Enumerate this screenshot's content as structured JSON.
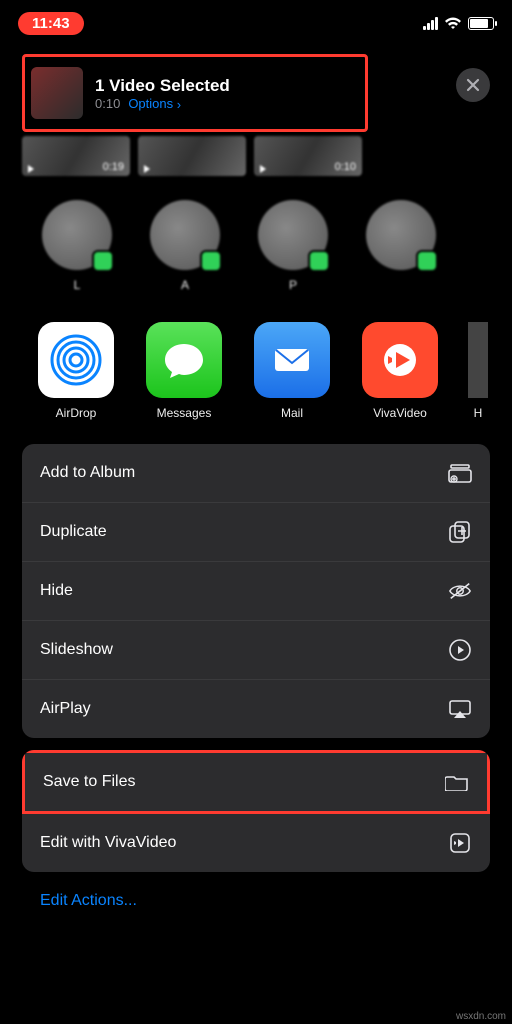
{
  "status": {
    "time": "11:43"
  },
  "header": {
    "title": "1 Video Selected",
    "duration": "0:10",
    "options_label": "Options",
    "chevron": "›"
  },
  "videos": [
    {
      "duration": "0:19"
    },
    {
      "duration": ""
    },
    {
      "duration": "0:10"
    }
  ],
  "contacts": [
    {
      "name": "L"
    },
    {
      "name": "A"
    },
    {
      "name": "P"
    },
    {
      "name": ""
    }
  ],
  "apps": [
    {
      "label": "AirDrop"
    },
    {
      "label": "Messages"
    },
    {
      "label": "Mail"
    },
    {
      "label": "VivaVideo"
    },
    {
      "label": "H"
    }
  ],
  "actions_group1": [
    {
      "label": "Add to Album",
      "icon": "album"
    },
    {
      "label": "Duplicate",
      "icon": "duplicate"
    },
    {
      "label": "Hide",
      "icon": "hide"
    },
    {
      "label": "Slideshow",
      "icon": "slideshow"
    },
    {
      "label": "AirPlay",
      "icon": "airplay"
    }
  ],
  "actions_group2": [
    {
      "label": "Save to Files",
      "icon": "folder",
      "highlighted": true
    },
    {
      "label": "Edit with VivaVideo",
      "icon": "viva-edit"
    }
  ],
  "edit_actions": "Edit Actions...",
  "credit": "wsxdn.com"
}
